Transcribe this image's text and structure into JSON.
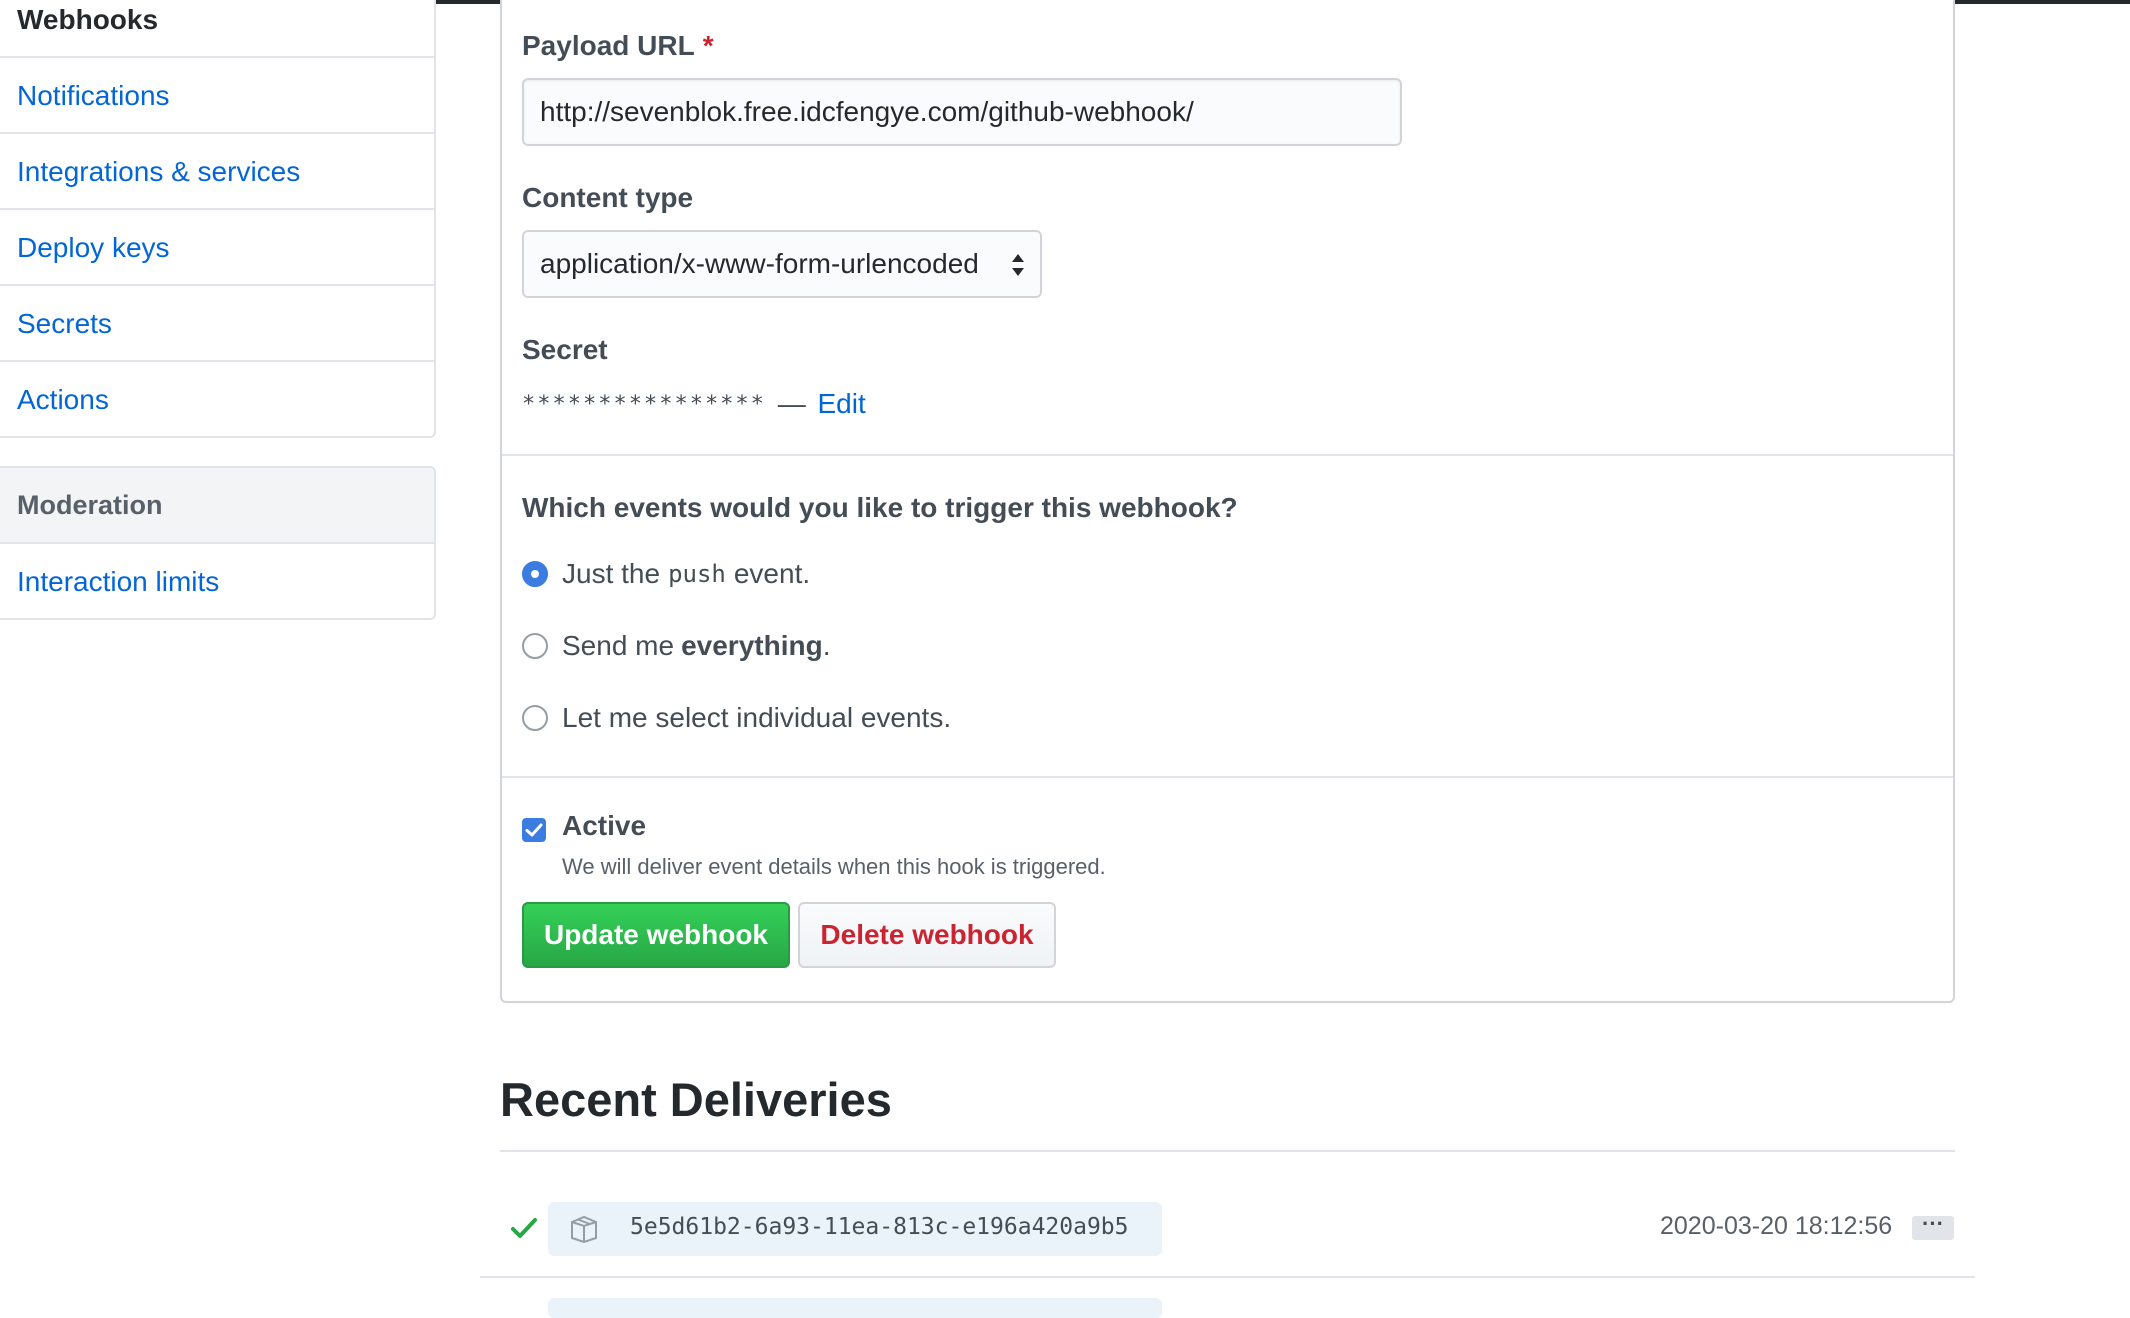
{
  "sidebar": {
    "current": "Webhooks",
    "items": [
      "Notifications",
      "Integrations & services",
      "Deploy keys",
      "Secrets",
      "Actions"
    ],
    "moderation_header": "Moderation",
    "moderation_items": [
      "Interaction limits"
    ]
  },
  "form": {
    "payload_url_label": "Payload URL",
    "required_mark": "*",
    "payload_url_value": "http://sevenblok.free.idcfengye.com/github-webhook/",
    "content_type_label": "Content type",
    "content_type_value": "application/x-www-form-urlencoded",
    "secret_label": "Secret",
    "secret_mask": "****************",
    "secret_dash": "—",
    "secret_edit": "Edit",
    "events_question": "Which events would you like to trigger this webhook?",
    "event_options": [
      {
        "prefix": "Just the",
        "code": "push",
        "suffix": "event.",
        "selected": true
      },
      {
        "prefix": "Send me",
        "bold": "everything",
        "suffix": ".",
        "selected": false
      },
      {
        "text": "Let me select individual events.",
        "selected": false
      }
    ],
    "active_label": "Active",
    "active_checked": true,
    "active_note": "We will deliver event details when this hook is triggered.",
    "update_button": "Update webhook",
    "delete_button": "Delete webhook"
  },
  "deliveries": {
    "title": "Recent Deliveries",
    "rows": [
      {
        "status": "success",
        "guid": "5e5d61b2-6a93-11ea-813c-e196a420a9b5",
        "timestamp": "2020-03-20 18:12:56",
        "more": "···"
      }
    ]
  },
  "colors": {
    "link": "#0366d6",
    "primary_button": "#28a745",
    "danger_text": "#cb2431",
    "success_check": "#28a745",
    "radio_selected": "#3b7ce0"
  }
}
